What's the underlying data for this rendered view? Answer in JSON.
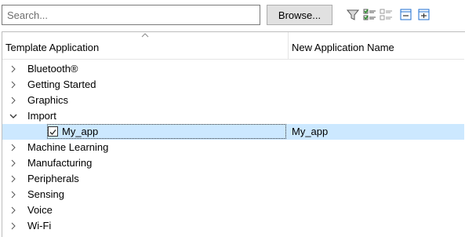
{
  "toolbar": {
    "search_placeholder": "Search...",
    "browse_label": "Browse..."
  },
  "tree": {
    "columns": [
      "Template Application",
      "New Application Name"
    ],
    "items": [
      {
        "label": "Bluetooth®",
        "expanded": false
      },
      {
        "label": "Getting Started",
        "expanded": false
      },
      {
        "label": "Graphics",
        "expanded": false
      },
      {
        "label": "Import",
        "expanded": true
      },
      {
        "label": "Machine Learning",
        "expanded": false
      },
      {
        "label": "Manufacturing",
        "expanded": false
      },
      {
        "label": "Peripherals",
        "expanded": false
      },
      {
        "label": "Sensing",
        "expanded": false
      },
      {
        "label": "Voice",
        "expanded": false
      },
      {
        "label": "Wi-Fi",
        "expanded": false
      }
    ],
    "child": {
      "label": "My_app",
      "new_name": "My_app",
      "checked": true
    }
  },
  "colors": {
    "selection": "#cce8ff",
    "accent": "#1c6ed1"
  }
}
